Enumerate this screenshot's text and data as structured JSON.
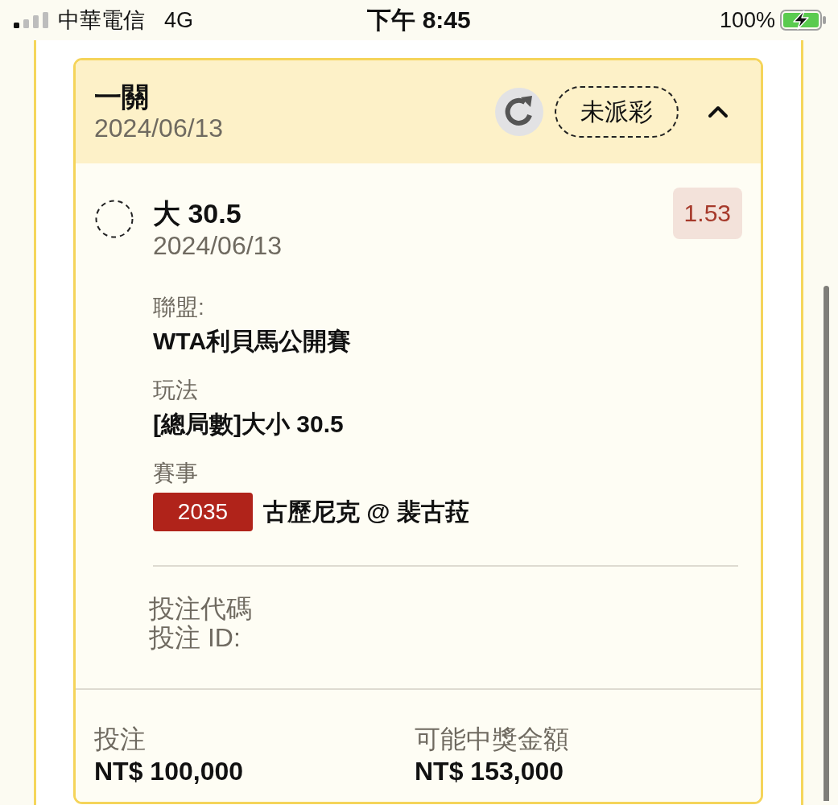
{
  "status_bar": {
    "carrier": "中華電信",
    "network": "4G",
    "time": "下午 8:45",
    "battery": "100%"
  },
  "bet_card": {
    "title": "一關",
    "date": "2024/06/13",
    "status": "未派彩",
    "expanded": true,
    "selections": [
      {
        "pick": "大 30.5",
        "date": "2024/06/13",
        "odds": "1.53",
        "details": [
          {
            "kind": "text",
            "label": "聯盟:",
            "value": "WTA利貝馬公開賽"
          },
          {
            "kind": "text",
            "label": "玩法",
            "value": "[總局數]大小 30.5"
          },
          {
            "kind": "match",
            "label": "賽事",
            "match_no": "2035",
            "value": "古歷尼克 @ 裴古菈"
          }
        ]
      }
    ],
    "references": [
      "投注代碼",
      "投注 ID:"
    ],
    "totals": [
      {
        "label": "投注",
        "value": "NT$ 100,000"
      },
      {
        "label": "可能中獎金額",
        "value": "NT$ 153,000"
      }
    ]
  }
}
